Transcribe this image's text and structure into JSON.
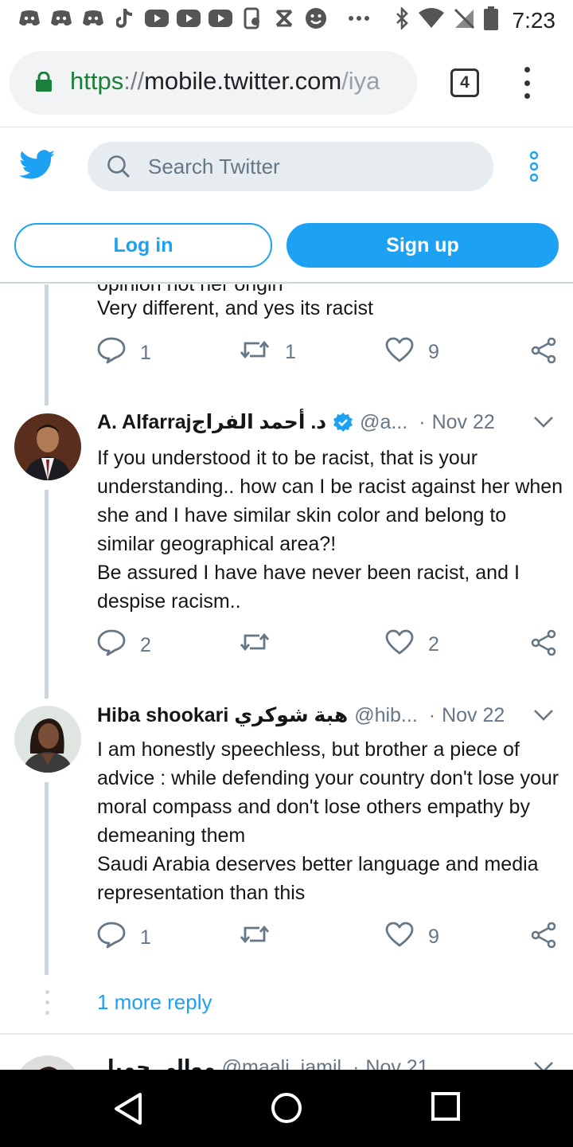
{
  "status_bar": {
    "time": "7:23",
    "left_icons": [
      "discord-icon",
      "discord-icon",
      "discord-icon",
      "tiktok-icon",
      "youtube-icon",
      "youtube-icon",
      "youtube-icon",
      "screen-record-icon",
      "x-icon",
      "smiley-icon",
      "more-notifications-icon"
    ],
    "right_icons": [
      "bluetooth-icon",
      "wifi-icon",
      "no-sim-icon",
      "battery-icon"
    ]
  },
  "browser": {
    "url_scheme": "https",
    "url_separator": "://",
    "url_host": "mobile.twitter.com",
    "url_path": "/iya",
    "tab_count": "4"
  },
  "twitter_header": {
    "search_placeholder": "Search Twitter",
    "login_label": "Log in",
    "signup_label": "Sign up",
    "accent_color": "#1da1f2"
  },
  "tweets": [
    {
      "text_cut": "opinion not her origin",
      "text": "Very different, and yes its racist",
      "replies": "1",
      "retweets": "1",
      "likes": "9"
    },
    {
      "name": "A. Alfarrajد. أحمد الفراج",
      "verified": true,
      "handle": "@a...",
      "date": "Nov 22",
      "text": "If you understood it to be racist, that is your understanding.. how can I be racist against her when she and I have similar skin color and belong to similar geographical area?!\nBe assured I have have never been racist, and I despise racism..",
      "replies": "2",
      "retweets": "",
      "likes": "2"
    },
    {
      "name": "Hiba shookari هبة شوكري",
      "verified": false,
      "handle": "@hib...",
      "date": "Nov 22",
      "text": "I am honestly speechless, but brother a piece of advice : while defending your country don't lose your moral compass and don't lose others empathy by demeaning them\nSaudi Arabia deserves better language and media representation than this",
      "replies": "1",
      "retweets": "",
      "likes": "9"
    },
    {
      "name": "موالي جميل",
      "handle": "@maali_jamil",
      "date": "Nov 21"
    }
  ],
  "more_reply_label": "1 more reply",
  "nav_icons": [
    "back-icon",
    "home-icon",
    "recents-icon"
  ]
}
